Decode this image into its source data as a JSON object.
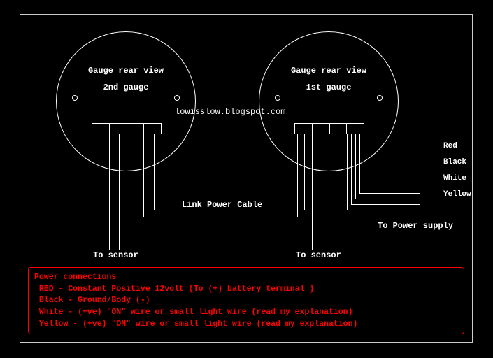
{
  "watermark": "lowisslow.blogspot.com",
  "gauge_left": {
    "title": "Gauge rear view",
    "subtitle": "2nd gauge"
  },
  "gauge_right": {
    "title": "Gauge rear view",
    "subtitle": "1st gauge"
  },
  "labels": {
    "link_cable": "Link Power Cable",
    "to_sensor_left": "To sensor",
    "to_sensor_right": "To sensor",
    "to_power_supply": "To Power supply",
    "wire_red": "Red",
    "wire_black": "Black",
    "wire_white": "White",
    "wire_yellow": "Yellow"
  },
  "legend": {
    "heading": "Power connections",
    "red": "RED - Constant Positive 12volt {To (+) battery terminal }",
    "black": "Black - Ground/Body (-)",
    "white": "White - (+ve) \"ON\" wire or small light wire (read my explanation)",
    "yellow": "Yellow - (+ve) \"ON\" wire or small light wire (read my explanation)"
  }
}
